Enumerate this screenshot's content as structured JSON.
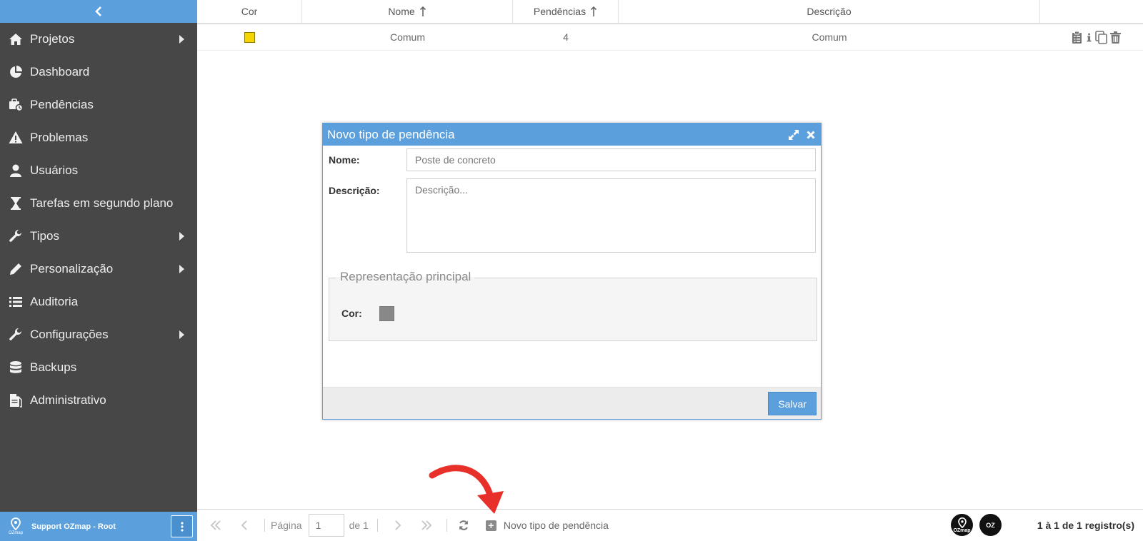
{
  "sidebar": {
    "collapse_icon": "chevron-left-icon",
    "items": [
      {
        "label": "Projetos",
        "icon": "home-icon",
        "has_submenu": true
      },
      {
        "label": "Dashboard",
        "icon": "pie-chart-icon",
        "has_submenu": false
      },
      {
        "label": "Pendências",
        "icon": "briefcase-clock-icon",
        "has_submenu": false
      },
      {
        "label": "Problemas",
        "icon": "warning-icon",
        "has_submenu": false
      },
      {
        "label": "Usuários",
        "icon": "user-icon",
        "has_submenu": false
      },
      {
        "label": "Tarefas em segundo plano",
        "icon": "hourglass-icon",
        "has_submenu": false
      },
      {
        "label": "Tipos",
        "icon": "wrench-icon",
        "has_submenu": true
      },
      {
        "label": "Personalização",
        "icon": "pencil-icon",
        "has_submenu": true
      },
      {
        "label": "Auditoria",
        "icon": "list-icon",
        "has_submenu": false
      },
      {
        "label": "Configurações",
        "icon": "wrench-icon",
        "has_submenu": true
      },
      {
        "label": "Backups",
        "icon": "database-icon",
        "has_submenu": false
      },
      {
        "label": "Administrativo",
        "icon": "document-icon",
        "has_submenu": false
      }
    ],
    "footer": {
      "logo_text": "OZmap",
      "user": "Support OZmap - Root"
    }
  },
  "table": {
    "columns": [
      "Cor",
      "Nome",
      "Pendências",
      "Descrição",
      ""
    ],
    "rows": [
      {
        "color": "#f5d400",
        "nome": "Comum",
        "pendencias": "4",
        "descricao": "Comum"
      }
    ]
  },
  "modal": {
    "title": "Novo tipo de pendência",
    "nome_label": "Nome:",
    "nome_value": "Poste de concreto",
    "descricao_label": "Descrição:",
    "descricao_placeholder": "Descrição...",
    "fieldset_legend": "Representação principal",
    "cor_label": "Cor:",
    "cor_value": "#888888",
    "save_label": "Salvar"
  },
  "pager": {
    "page_label": "Página",
    "page_value": "1",
    "of_label": "de 1",
    "add_label": "Novo tipo de pendência",
    "brand_left": "OZmap",
    "brand_right": "OZ",
    "records": "1 à 1 de 1 registro(s)"
  },
  "colors": {
    "accent": "#5b9fdc",
    "sidebar_bg": "#474747",
    "annotation_arrow": "#e8302a"
  }
}
